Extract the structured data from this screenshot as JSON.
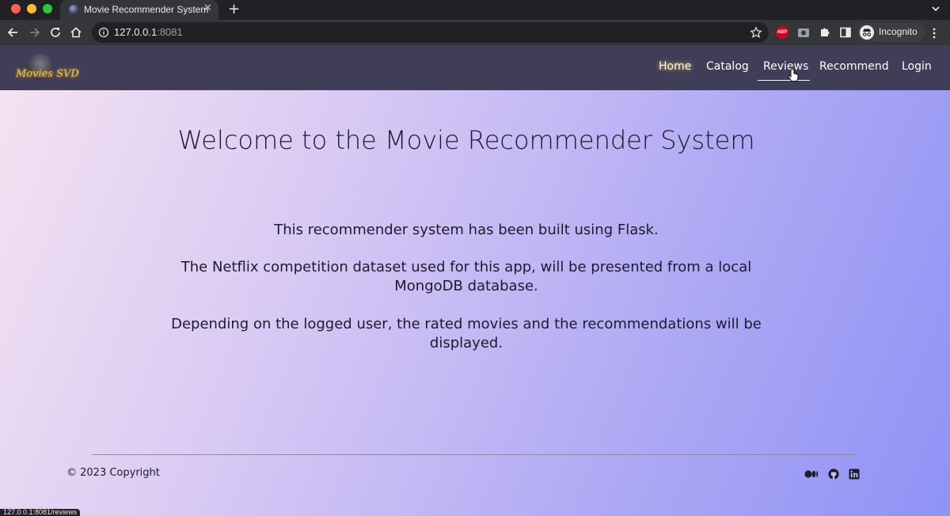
{
  "browser": {
    "tab_title": "Movie Recommender System",
    "tab_close": "✕",
    "new_tab": "+",
    "url_host": "127.0.0.1",
    "url_port": ":8081",
    "incognito_label": "Incognito",
    "abp_label": "ABP",
    "status_url": "127.0.0.1:8081/reviews"
  },
  "site": {
    "logo_text": "Movies SVD",
    "nav": {
      "home": "Home",
      "catalog": "Catalog",
      "reviews": "Reviews",
      "recommend": "Recommend",
      "login": "Login"
    },
    "active_link": "Home",
    "hovered_link": "Reviews"
  },
  "main": {
    "title": "Welcome to the Movie Recommender System",
    "paragraph_1": "This recommender system has been built using Flask.",
    "paragraph_2": "The Netflix competition dataset used for this app, will be presented from a local MongoDB database.",
    "paragraph_3": "Depending on the logged user, the rated movies and the recommendations will be displayed."
  },
  "footer": {
    "copyright": "© 2023 Copyright",
    "social_icons": [
      "medium-icon",
      "github-icon",
      "linkedin-icon"
    ]
  },
  "colors": {
    "nav_bg": "#3f3d57",
    "home_glow": "#f7d66a",
    "gradient_start": "#f6e3f1",
    "gradient_end": "#8f92f6"
  }
}
